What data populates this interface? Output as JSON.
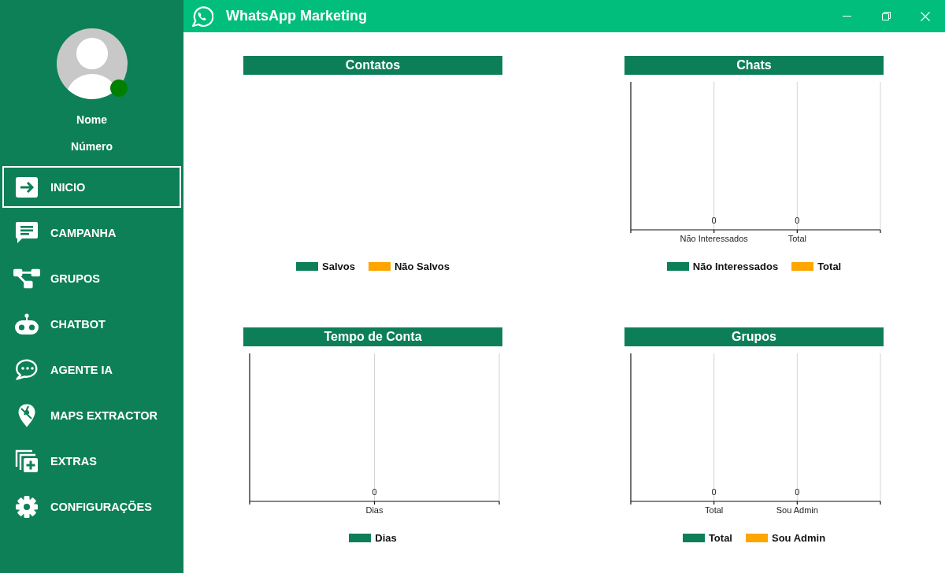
{
  "window": {
    "title": "WhatsApp Marketing"
  },
  "sidebar": {
    "profile": {
      "name": "Nome",
      "subtitle": "Número",
      "online": true
    },
    "items": [
      {
        "label": "INICIO",
        "selected": true
      },
      {
        "label": "CAMPANHA",
        "selected": false
      },
      {
        "label": "GRUPOS",
        "selected": false
      },
      {
        "label": "CHATBOT",
        "selected": false
      },
      {
        "label": "AGENTE IA",
        "selected": false
      },
      {
        "label": "MAPS EXTRACTOR",
        "selected": false
      },
      {
        "label": "EXTRAS",
        "selected": false
      },
      {
        "label": "CONFIGURAÇÕES",
        "selected": false
      }
    ]
  },
  "panels": [
    {
      "title": "Contatos",
      "legend": [
        {
          "label": "Salvos",
          "color": "#0c7f58"
        },
        {
          "label": "Não Salvos",
          "color": "#ffa500"
        }
      ]
    },
    {
      "title": "Chats",
      "plot": {
        "categories": [
          "Não Interessados",
          "Total"
        ],
        "value_labels": [
          "0",
          "0"
        ]
      },
      "legend": [
        {
          "label": "Não Interessados",
          "color": "#0c7f58"
        },
        {
          "label": "Total",
          "color": "#ffa500"
        }
      ]
    },
    {
      "title": "Tempo de Conta",
      "plot": {
        "categories": [
          "Dias"
        ],
        "value_labels": [
          "0"
        ]
      },
      "legend": [
        {
          "label": "Dias",
          "color": "#0c7f58"
        }
      ]
    },
    {
      "title": "Grupos",
      "plot": {
        "categories": [
          "Total",
          "Sou Admin"
        ],
        "value_labels": [
          "0",
          "0"
        ]
      },
      "legend": [
        {
          "label": "Total",
          "color": "#0c7f58"
        },
        {
          "label": "Sou Admin",
          "color": "#ffa500"
        }
      ]
    }
  ]
}
